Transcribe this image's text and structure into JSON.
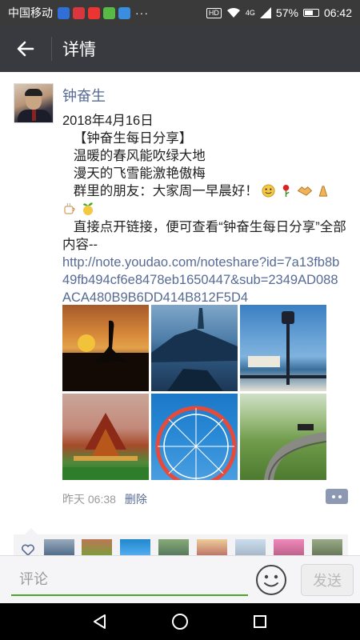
{
  "status_bar": {
    "carrier": "中国移动",
    "dots": "···",
    "battery": "57%",
    "time": "06:42",
    "hd": "HD",
    "signal": "4G"
  },
  "header": {
    "title": "详情"
  },
  "post": {
    "author": "钟奋生",
    "date": "2018年4月16日",
    "lines": [
      "   【钟奋生每日分享】",
      "   温暖的春风能吹绿大地",
      "   漫天的飞雪能激艳傲梅",
      "   群里的朋友：大家周一早晨好！"
    ],
    "body": "   直接点开链接，便可查看“钟奋生每日分享”全部内容--",
    "link": "http://note.youdao.com/noteshare?id=7a13fb8b49fb494cf6e8478eb1650447&sub=2349AD088ACA480B9B6DD414B812F5D4",
    "time": "昨天 06:38",
    "delete_label": "删除"
  },
  "input": {
    "placeholder": "评论",
    "send_label": "发送"
  },
  "colors": {
    "link": "#576b95",
    "header_bg": "#393a3f",
    "accent_green": "#4aa829"
  }
}
